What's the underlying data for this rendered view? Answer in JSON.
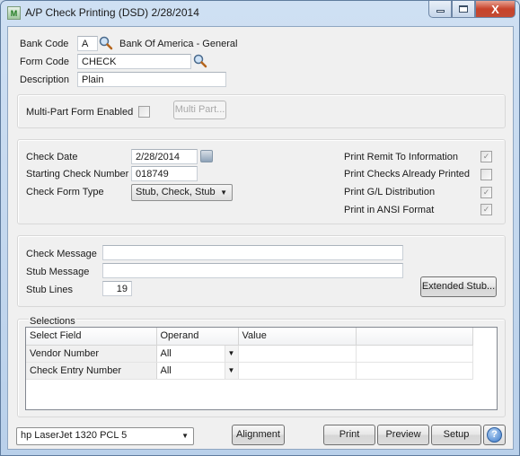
{
  "window": {
    "title": "A/P Check Printing (DSD) 2/28/2014",
    "app_icon": "sage-mas-app-icon",
    "caption_buttons": {
      "minimize": "minimize-icon",
      "maximize": "maximize-icon",
      "close": "X"
    }
  },
  "header": {
    "bank_code_label": "Bank Code",
    "bank_code_value": "A",
    "bank_name": "Bank Of America - General",
    "form_code_label": "Form Code",
    "form_code_value": "CHECK",
    "description_label": "Description",
    "description_value": "Plain"
  },
  "multipart": {
    "label": "Multi-Part Form Enabled",
    "checked": false,
    "button_label": "Multi Part..."
  },
  "options": {
    "check_date_label": "Check Date",
    "check_date_value": "2/28/2014",
    "starting_check_number_label": "Starting Check Number",
    "starting_check_number_value": "018749",
    "check_form_type_label": "Check Form Type",
    "check_form_type_value": "Stub, Check, Stub",
    "checkboxes": [
      {
        "label": "Print Remit To Information",
        "checked": true
      },
      {
        "label": "Print Checks Already Printed",
        "checked": false
      },
      {
        "label": "Print G/L Distribution",
        "checked": true
      },
      {
        "label": "Print in ANSI Format",
        "checked": true
      }
    ]
  },
  "messages": {
    "check_message_label": "Check Message",
    "check_message_value": "",
    "stub_message_label": "Stub Message",
    "stub_message_value": "",
    "stub_lines_label": "Stub Lines",
    "stub_lines_value": "19",
    "extended_stub_button": "Extended Stub..."
  },
  "selections": {
    "title": "Selections",
    "columns": [
      "Select Field",
      "Operand",
      "Value",
      ""
    ],
    "rows": [
      {
        "field": "Vendor Number",
        "operand": "All",
        "value": "",
        "extra": ""
      },
      {
        "field": "Check Entry Number",
        "operand": "All",
        "value": "",
        "extra": ""
      }
    ]
  },
  "footer": {
    "printer": "hp LaserJet 1320 PCL 5",
    "alignment_button": "Alignment",
    "print_button": "Print",
    "preview_button": "Preview",
    "setup_button": "Setup",
    "help_button": "?"
  }
}
